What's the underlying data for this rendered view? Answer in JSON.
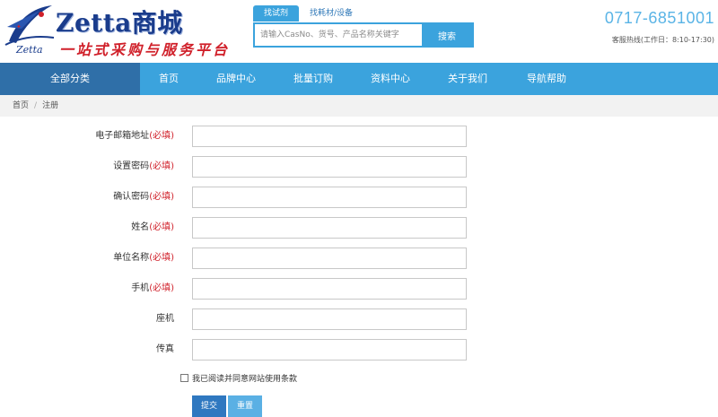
{
  "brand": {
    "title": "Zetta商城",
    "sub_mark": "Zetta",
    "slogan": "一站式采购与服务平台"
  },
  "search": {
    "tabs": [
      "找试剂",
      "找耗材/设备"
    ],
    "active_tab": 0,
    "placeholder": "请输入CasNo、货号、产品名称关键字",
    "button_label": "搜索"
  },
  "hotline": {
    "number": "0717-6851001",
    "label": "客服热线(工作日：8:10-17:30)"
  },
  "nav": {
    "all_categories": "全部分类",
    "items": [
      "首页",
      "品牌中心",
      "批量订购",
      "资料中心",
      "关于我们",
      "导航帮助"
    ]
  },
  "breadcrumb": {
    "home": "首页",
    "separator": "/",
    "current": "注册"
  },
  "form": {
    "required_mark": "(必填)",
    "fields": [
      {
        "label": "电子邮箱地址",
        "required": true
      },
      {
        "label": "设置密码",
        "required": true
      },
      {
        "label": "确认密码",
        "required": true
      },
      {
        "label": "姓名",
        "required": true
      },
      {
        "label": "单位名称",
        "required": true
      },
      {
        "label": "手机",
        "required": true
      },
      {
        "label": "座机",
        "required": false
      },
      {
        "label": "传真",
        "required": false
      }
    ],
    "agree_text": "我已阅读并同意网站使用条款",
    "submit_label": "提交",
    "reset_label": "重置"
  },
  "colors": {
    "nav_bg": "#3ba3dd",
    "nav_active": "#2f6fa8",
    "required": "#d0202a",
    "hotline": "#5ab4e6",
    "brand": "#1a3c8c"
  }
}
